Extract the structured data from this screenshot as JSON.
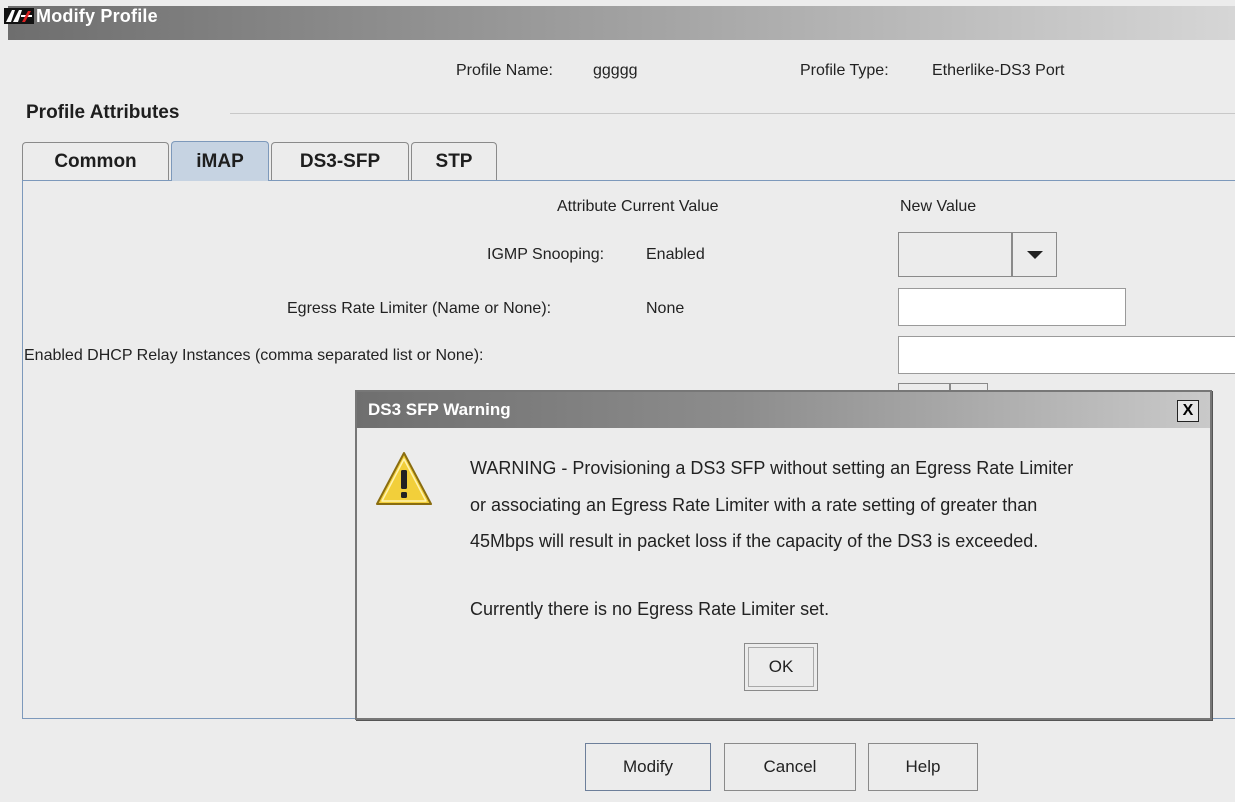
{
  "window": {
    "title": "Modify Profile",
    "logo_icon": "allied-telesis-logo"
  },
  "profile": {
    "name_label": "Profile Name:",
    "name_value": "ggggg",
    "type_label": "Profile Type:",
    "type_value": "Etherlike-DS3 Port"
  },
  "attributes": {
    "section_title": "Profile Attributes",
    "tabs": [
      {
        "label": "Common",
        "active": false
      },
      {
        "label": "iMAP",
        "active": true
      },
      {
        "label": "DS3-SFP",
        "active": false
      },
      {
        "label": "STP",
        "active": false
      }
    ],
    "header_attr_current": "Attribute Current Value",
    "header_new": "New Value",
    "rows": [
      {
        "label": "IGMP Snooping:",
        "current": "Enabled",
        "new_value": ""
      },
      {
        "label": "Egress Rate Limiter (Name or None):",
        "current": "None",
        "new_value": ""
      },
      {
        "label": "Enabled DHCP Relay Instances (comma separated list or None):",
        "current": "",
        "new_value": ""
      }
    ]
  },
  "dialog": {
    "title": "DS3 SFP Warning",
    "close_label": "X",
    "icon": "warning-triangle-icon",
    "message_lines": [
      "WARNING - Provisioning a DS3 SFP without setting an Egress Rate Limiter",
      "or associating an Egress Rate Limiter with a rate setting of greater than",
      "45Mbps will result in packet loss if the capacity of the DS3 is exceeded.",
      "Currently there is no Egress Rate Limiter set."
    ],
    "ok_label": "OK"
  },
  "buttons": {
    "modify": "Modify",
    "cancel": "Cancel",
    "help": "Help"
  },
  "colors": {
    "active_tab": "#c6d3e2",
    "panel_border": "#7d99bb",
    "background": "#ececec",
    "warning_yellow": "#f2cf3a"
  }
}
